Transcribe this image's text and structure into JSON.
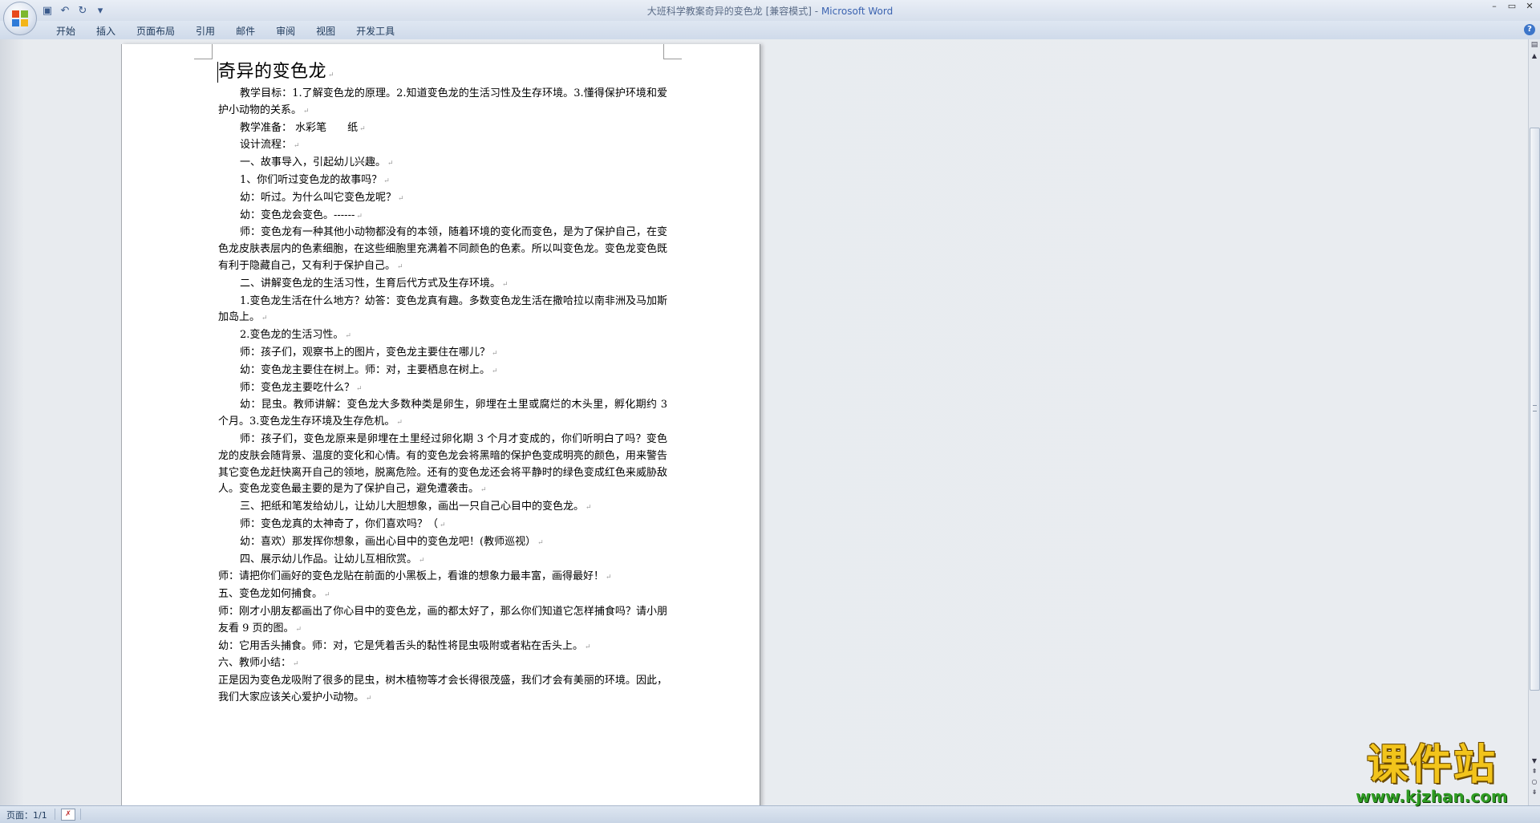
{
  "titlebar": {
    "document_title": "大班科学教案奇异的变色龙 [兼容模式]",
    "separator": " - ",
    "app_name": "Microsoft Word",
    "qat": [
      {
        "icon": "save-icon",
        "glyph": "▣"
      },
      {
        "icon": "undo-icon",
        "glyph": "↶"
      },
      {
        "icon": "redo-icon",
        "glyph": "↻"
      },
      {
        "icon": "customize-icon",
        "glyph": "▾"
      }
    ],
    "window_controls": {
      "minimize": "–",
      "restore": "▭",
      "close": "✕"
    }
  },
  "ribbon": {
    "tabs": [
      "开始",
      "插入",
      "页面布局",
      "引用",
      "邮件",
      "审阅",
      "视图",
      "开发工具"
    ],
    "help": "?"
  },
  "document": {
    "title": "奇异的变色龙",
    "paragraph_mark": "↵",
    "paragraphs": [
      {
        "text": "教学目标：1.了解变色龙的原理。2.知道变色龙的生活习性及生存环境。3.懂得保护环境和爱护小动物的关系。",
        "indent": true
      },
      {
        "text": "教学准备： 水彩笔　　纸",
        "indent": true
      },
      {
        "text": "设计流程：",
        "indent": true
      },
      {
        "text": "一、故事导入，引起幼儿兴趣。",
        "indent": true
      },
      {
        "text": "1、你们听过变色龙的故事吗？",
        "indent": true
      },
      {
        "text": "幼：听过。为什么叫它变色龙呢？",
        "indent": true
      },
      {
        "text": "幼：变色龙会变色。------",
        "indent": true
      },
      {
        "text": "师：变色龙有一种其他小动物都没有的本领，随着环境的变化而变色，是为了保护自己，在变色龙皮肤表层内的色素细胞，在这些细胞里充满着不同颜色的色素。所以叫变色龙。变色龙变色既有利于隐藏自己，又有利于保护自己。",
        "indent": true
      },
      {
        "text": "二、讲解变色龙的生活习性，生育后代方式及生存环境。",
        "indent": true
      },
      {
        "text": "1.变色龙生活在什么地方？幼答：变色龙真有趣。多数变色龙生活在撒哈拉以南非洲及马加斯加岛上。",
        "indent": true
      },
      {
        "text": "2.变色龙的生活习性。",
        "indent": true
      },
      {
        "text": "师：孩子们，观察书上的图片，变色龙主要住在哪儿？",
        "indent": true
      },
      {
        "text": "幼：变色龙主要住在树上。师：对，主要栖息在树上。",
        "indent": true
      },
      {
        "text": "师：变色龙主要吃什么？",
        "indent": true
      },
      {
        "text": "幼：昆虫。教师讲解：变色龙大多数种类是卵生，卵埋在土里或腐烂的木头里，孵化期约 3 个月。3.变色龙生存环境及生存危机。",
        "indent": true
      },
      {
        "text": "师：孩子们，变色龙原来是卵埋在土里经过卵化期 3 个月才变成的，你们听明白了吗？变色龙的皮肤会随背景、温度的变化和心情。有的变色龙会将黑暗的保护色变成明亮的颜色，用来警告其它变色龙赶快离开自己的领地，脱离危险。还有的变色龙还会将平静时的绿色变成红色来威胁敌人。变色龙变色最主要的是为了保护自己，避免遭袭击。",
        "indent": true
      },
      {
        "text": "三、把纸和笔发给幼儿，让幼儿大胆想象，画出一只自己心目中的变色龙。",
        "indent": true
      },
      {
        "text": "师：变色龙真的太神奇了，你们喜欢吗？（",
        "indent": true
      },
      {
        "text": "幼：喜欢）那发挥你想象，画出心目中的变色龙吧！(教师巡视）",
        "indent": true
      },
      {
        "text": "四、展示幼儿作品。让幼儿互相欣赏。",
        "indent": true
      },
      {
        "text": "师：请把你们画好的变色龙贴在前面的小黑板上，看谁的想象力最丰富，画得最好！",
        "indent": false
      },
      {
        "text": "五、变色龙如何捕食。",
        "indent": false
      },
      {
        "text": "师：刚才小朋友都画出了你心目中的变色龙，画的都太好了，那么你们知道它怎样捕食吗？请小朋友看 9 页的图。",
        "indent": false
      },
      {
        "text": "幼：它用舌头捕食。师：对，它是凭着舌头的黏性将昆虫吸附或者粘在舌头上。",
        "indent": false
      },
      {
        "text": "六、教师小结：",
        "indent": false
      },
      {
        "text": "正是因为变色龙吸附了很多的昆虫，树木植物等才会长得很茂盛，我们才会有美丽的环境。因此，我们大家应该关心爱护小动物。",
        "indent": false
      }
    ]
  },
  "statusbar": {
    "page_label": "页面：1/1"
  },
  "watermark": {
    "text": "课件站",
    "url": "www.kjzhan.com"
  },
  "colors": {
    "app_name": "#3b63b0",
    "watermark_text": "#f2c41b",
    "watermark_url": "#2f9c23"
  }
}
